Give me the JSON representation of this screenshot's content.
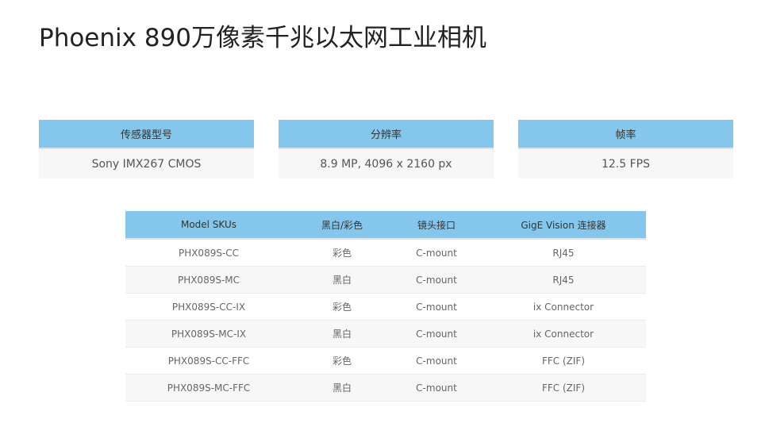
{
  "title": "Phoenix 890万像素千兆以太网工业相机",
  "specs": [
    {
      "label": "传感器型号",
      "value": "Sony IMX267 CMOS"
    },
    {
      "label": "分辨率",
      "value": "8.9 MP, 4096 x 2160 px"
    },
    {
      "label": "帧率",
      "value": "12.5 FPS"
    }
  ],
  "table": {
    "headers": [
      "Model SKUs",
      "黑白/彩色",
      "镜头接口",
      "GigE Vision 连接器"
    ],
    "rows": [
      [
        "PHX089S-CC",
        "彩色",
        "C-mount",
        "RJ45"
      ],
      [
        "PHX089S-MC",
        "黑白",
        "C-mount",
        "RJ45"
      ],
      [
        "PHX089S-CC-IX",
        "彩色",
        "C-mount",
        "ix Connector"
      ],
      [
        "PHX089S-MC-IX",
        "黑白",
        "C-mount",
        "ix Connector"
      ],
      [
        "PHX089S-CC-FFC",
        "彩色",
        "C-mount",
        "FFC (ZIF)"
      ],
      [
        "PHX089S-MC-FFC",
        "黑白",
        "C-mount",
        "FFC (ZIF)"
      ]
    ]
  },
  "colors": {
    "header_blue": "#84c6ec",
    "row_alt": "#f7f7f7"
  }
}
